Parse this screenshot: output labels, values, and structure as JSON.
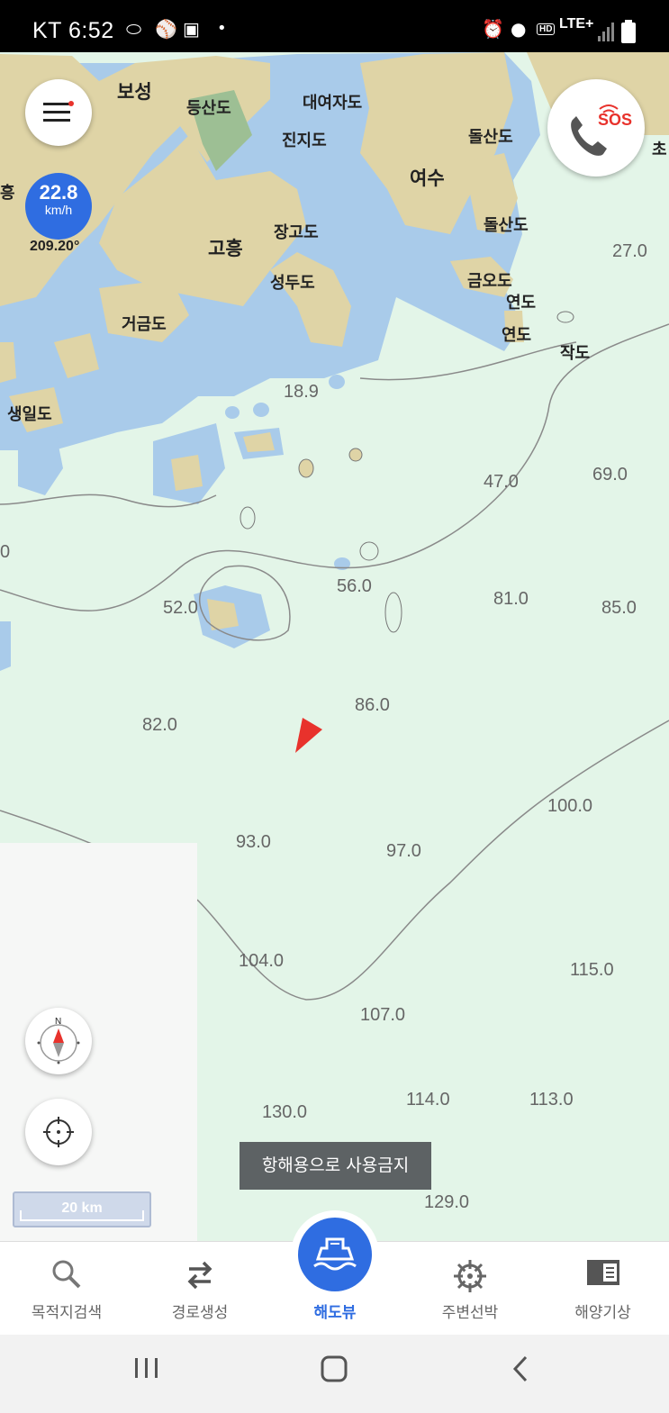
{
  "status_bar": {
    "carrier_time": "KT 6:52",
    "network": "LTE+",
    "hd": "HD",
    "dot": "•"
  },
  "speed": {
    "value": "22.8",
    "unit": "km/h",
    "heading": "209.20°"
  },
  "place_names": {
    "boseong": "보성",
    "deungsando": "등산도",
    "daeyeojado": "대여자도",
    "jinjido": "진지도",
    "dolsando_top": "돌산도",
    "yeosu": "여수",
    "dolsando": "돌산도",
    "heung": "흥",
    "goheung": "고흥",
    "janggodo": "장고도",
    "seongdudo": "성두도",
    "geumodo": "금오도",
    "yeondo1": "연도",
    "yeondo2": "연도",
    "geogeumdo": "거금도",
    "jakdo": "작도",
    "saengildo": "생일도",
    "cho": "초"
  },
  "depths": [
    "27.0",
    "18.9",
    "47.0",
    "69.0",
    "56.0",
    "81.0",
    "85.0",
    "52.0",
    "86.0",
    "82.0",
    "100.0",
    "93.0",
    "97.0",
    "104.0",
    "115.0",
    "107.0",
    "130.0",
    "114.0",
    "113.0",
    "129.0",
    "0"
  ],
  "scale_label": "20 km",
  "notice": "항해용으로 사용금지",
  "sos_label": "SOS",
  "compass_label": "N",
  "nav": {
    "items": [
      {
        "label": "목적지검색",
        "icon": "search-icon"
      },
      {
        "label": "경로생성",
        "icon": "route-icon"
      },
      {
        "label": "해도뷰",
        "icon": "ship-icon",
        "active": true
      },
      {
        "label": "주변선박",
        "icon": "ship-wheel-icon"
      },
      {
        "label": "해양기상",
        "icon": "book-icon"
      }
    ]
  },
  "colors": {
    "land": "#dfd4a6",
    "shallow_water": "#a9cbea",
    "sea": "#e3f5e8",
    "accent": "#2f6de1",
    "sos_red": "#e8322c",
    "vessel_marker": "#e8322c"
  }
}
